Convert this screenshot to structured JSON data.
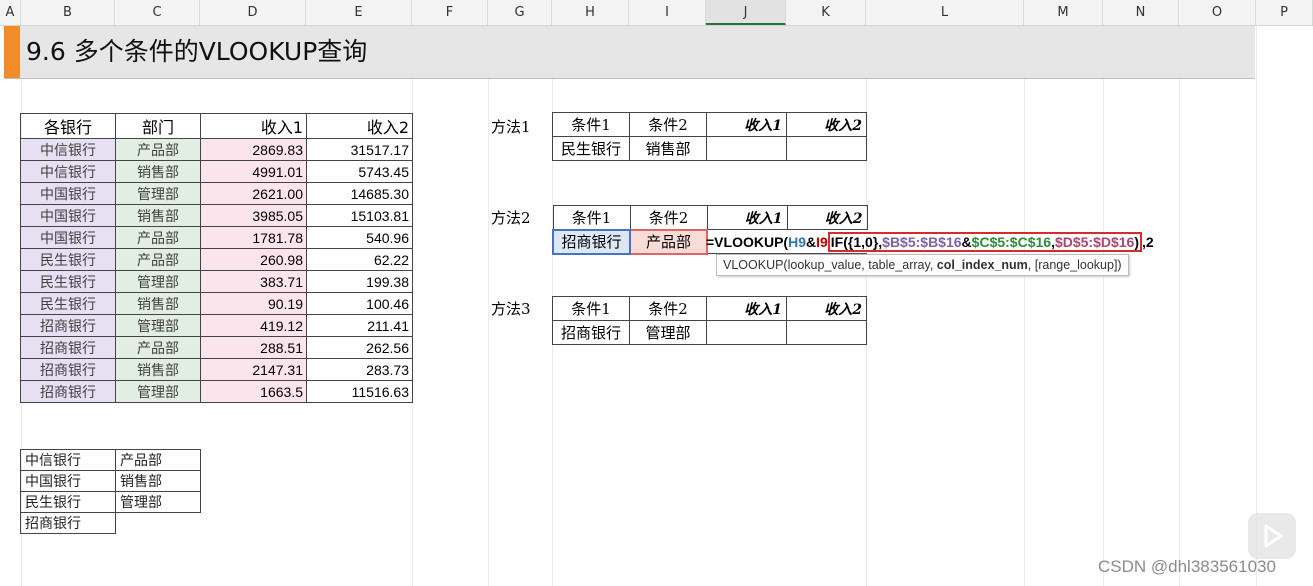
{
  "columns": [
    "A",
    "B",
    "C",
    "D",
    "E",
    "F",
    "G",
    "H",
    "I",
    "J",
    "K",
    "L",
    "M",
    "N",
    "O",
    "P"
  ],
  "active_column": "J",
  "title": "9.6 多个条件的VLOOKUP查询",
  "main_table": {
    "headers": [
      "各银行",
      "部门",
      "收入1",
      "收入2"
    ],
    "rows": [
      [
        "中信银行",
        "产品部",
        "2869.83",
        "31517.17"
      ],
      [
        "中信银行",
        "销售部",
        "4991.01",
        "5743.45"
      ],
      [
        "中国银行",
        "管理部",
        "2621.00",
        "14685.30"
      ],
      [
        "中国银行",
        "销售部",
        "3985.05",
        "15103.81"
      ],
      [
        "中国银行",
        "产品部",
        "1781.78",
        "540.96"
      ],
      [
        "民生银行",
        "产品部",
        "260.98",
        "62.22"
      ],
      [
        "民生银行",
        "管理部",
        "383.71",
        "199.38"
      ],
      [
        "民生银行",
        "销售部",
        "90.19",
        "100.46"
      ],
      [
        "招商银行",
        "管理部",
        "419.12",
        "211.41"
      ],
      [
        "招商银行",
        "产品部",
        "288.51",
        "262.56"
      ],
      [
        "招商银行",
        "销售部",
        "2147.31",
        "283.73"
      ],
      [
        "招商银行",
        "管理部",
        "1663.5",
        "11516.63"
      ]
    ]
  },
  "methods": [
    {
      "label": "方法1",
      "headers": [
        "条件1",
        "条件2",
        "收入1",
        "收入2"
      ],
      "values": [
        "民生银行",
        "销售部",
        "",
        ""
      ]
    },
    {
      "label": "方法2",
      "headers": [
        "条件1",
        "条件2",
        "收入1",
        "收入2"
      ],
      "values": [
        "招商银行",
        "产品部",
        "",
        ""
      ]
    },
    {
      "label": "方法3",
      "headers": [
        "条件1",
        "条件2",
        "收入1",
        "收入2"
      ],
      "values": [
        "招商银行",
        "管理部",
        "",
        ""
      ]
    }
  ],
  "formula": {
    "prefix": "=VLOOKUP(",
    "ref1": "H9",
    "amp1": "&",
    "ref2": "I9",
    "if_open": "IF(",
    "array": "{1,0}",
    "comma1": ",",
    "rangeB": "$B$5:$B$16",
    "amp2": "&",
    "rangeC": "$C$5:$C$16",
    "comma2": ",",
    "rangeD": "$D$5:$D$16",
    "if_close": ")",
    "suffix": ",2",
    "colors": {
      "ref1": "#2e75b6",
      "ref2": "#c00000",
      "rangeB": "#7f5fa6",
      "rangeC": "#2e8b3a",
      "rangeD": "#b0446c"
    }
  },
  "tooltip": {
    "func": "VLOOKUP(",
    "arg1": "lookup_value, table_array, ",
    "arg_bold": "col_index_num",
    "arg_rest": ", [range_lookup])"
  },
  "lookup_lists": {
    "banks": [
      "中信银行",
      "中国银行",
      "民生银行",
      "招商银行"
    ],
    "depts": [
      "产品部",
      "销售部",
      "管理部",
      ""
    ]
  },
  "watermark": "CSDN @dhl383561030",
  "colors": {
    "title_accent": "#f28c28",
    "selected_blue": "#4472c4",
    "selected_red": "#e06666",
    "formula_box": "#d62b2b"
  }
}
